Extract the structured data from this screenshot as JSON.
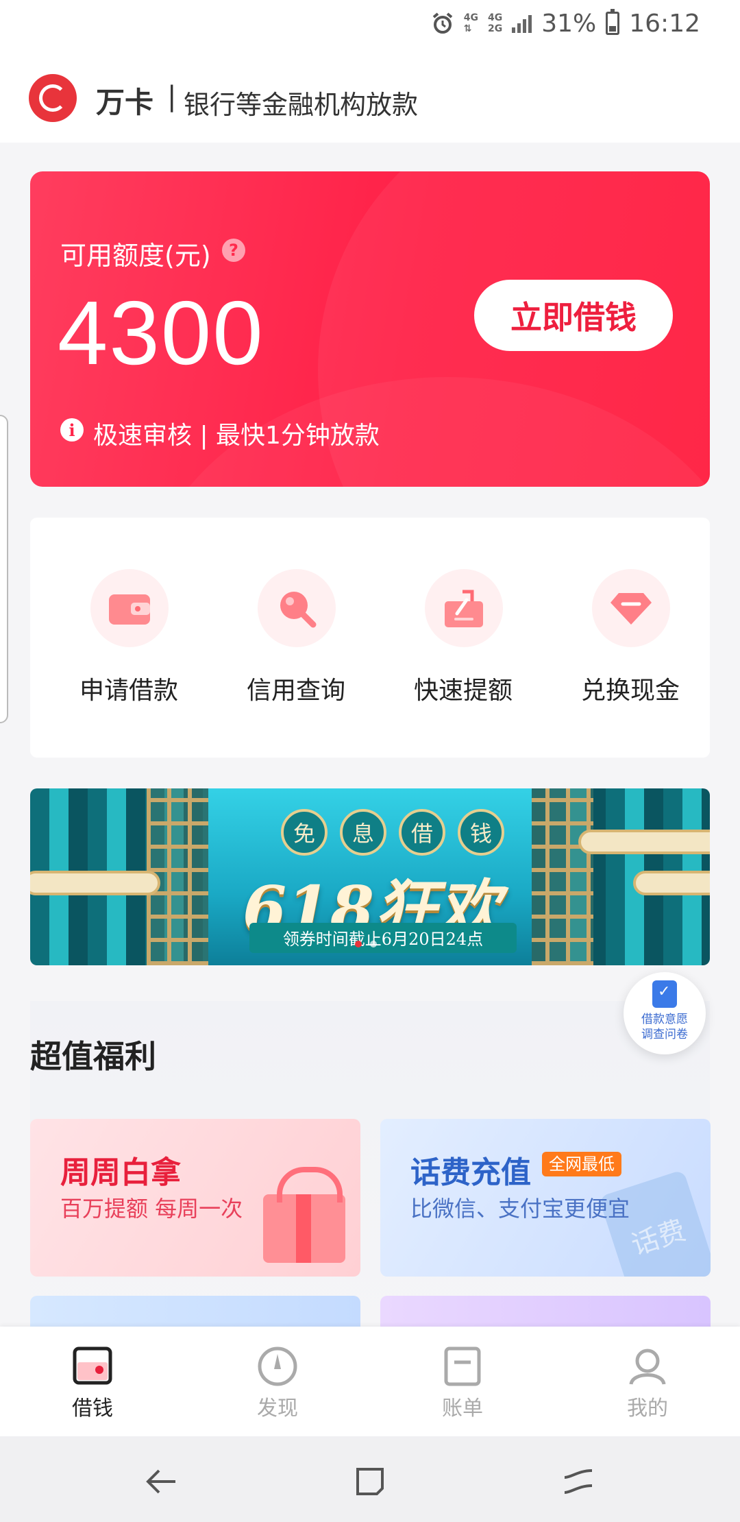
{
  "status_bar": {
    "network_top": "4G",
    "network_bottom": "4G",
    "network_sub": "2G",
    "battery": "31%",
    "time": "16:12",
    "icons": [
      "alarm-icon",
      "signal-icon",
      "battery-icon"
    ]
  },
  "header": {
    "brand": "万卡",
    "separator": "|",
    "subtitle": "银行等金融机构放款",
    "logo_icon": "wanka-logo-icon"
  },
  "credit_card": {
    "label": "可用额度(元)",
    "help": "?",
    "amount": "4300",
    "button": "立即借钱",
    "info_icon": "i",
    "info": "极速审核 | 最快1分钟放款",
    "accent": "#ff2047"
  },
  "quick_menu": [
    {
      "label": "申请借款",
      "icon": "wallet-icon"
    },
    {
      "label": "信用查询",
      "icon": "magnifier-icon"
    },
    {
      "label": "快速提额",
      "icon": "raise-limit-icon"
    },
    {
      "label": "兑换现金",
      "icon": "diamond-icon"
    }
  ],
  "banner": {
    "tags": [
      "免",
      "息",
      "借",
      "钱"
    ],
    "title": "618狂欢",
    "subtitle": "领券时间截止6月20日24点",
    "slide_index": 1,
    "slide_count": 2
  },
  "survey": {
    "line1": "借款意愿",
    "line2": "调查问卷",
    "icon": "clipboard-icon"
  },
  "benefits": {
    "title": "超值福利",
    "cards": [
      {
        "title": "周周白拿",
        "sub": "百万提额 每周一次",
        "icon": "gift-icon"
      },
      {
        "title": "话费充值",
        "tag": "全网最低",
        "sub": "比微信、支付宝更便宜",
        "icon": "phone-bill-icon",
        "watermark": "话费"
      }
    ]
  },
  "tab_bar": [
    {
      "label": "借钱",
      "icon": "wallet-tab-icon",
      "active": true
    },
    {
      "label": "发现",
      "icon": "compass-icon",
      "active": false
    },
    {
      "label": "账单",
      "icon": "bill-icon",
      "active": false
    },
    {
      "label": "我的",
      "icon": "person-icon",
      "active": false
    }
  ],
  "system_nav": [
    "back-icon",
    "recents-icon",
    "home-swipe-icon"
  ]
}
